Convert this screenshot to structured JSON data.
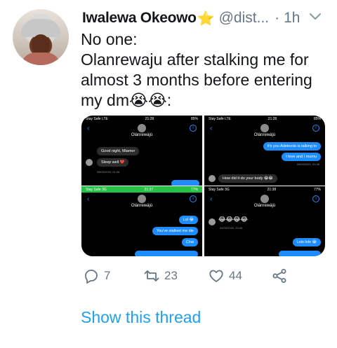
{
  "tweet": {
    "author_name": "Iwalewa Okeowo",
    "author_emoji": "⭐",
    "handle": "@dist...",
    "separator": "·",
    "time": "1h",
    "lines": [
      "No one:",
      "Olanrewaju after stalking me for",
      "almost 3 months before entering",
      "my dm😭😭:"
    ]
  },
  "media": {
    "screenshots": [
      {
        "status_left": "Stay Safe LTE",
        "status_time": "21:28",
        "status_right": "85%",
        "contact": "Olánrewájú",
        "messages": [
          {
            "dir": "in",
            "text": "Good night, Miamor"
          },
          {
            "dir": "in",
            "text": "Sleep well ❤️"
          }
        ],
        "stamp": "05/03/2020, 01:08"
      },
      {
        "status_left": "Stay Safe LTE",
        "status_time": "21:28",
        "status_right": "85%",
        "contact": "Olánrewájú",
        "messages": [
          {
            "dir": "out",
            "text": "It's you Adekunle is talking to"
          },
          {
            "dir": "out",
            "text": "I love and I mumu"
          },
          {
            "dir": "in",
            "text": "How did it do your body 😂😂"
          }
        ],
        "stamp": "05/03/2020, 01:46"
      },
      {
        "status_left": "Stay Safe 3G",
        "status_time": "21:37",
        "status_right": "77%",
        "contact": "Olánrewájú",
        "messages": [
          {
            "dir": "out",
            "text": "Lol 😂"
          },
          {
            "dir": "out",
            "text": "You've stalked me die"
          },
          {
            "dir": "out",
            "text": "Chai"
          }
        ],
        "stamp": ""
      },
      {
        "status_left": "Stay Safe 3G",
        "status_time": "21:38",
        "status_right": "77%",
        "contact": "Olánrewájú",
        "messages": [
          {
            "dir": "in",
            "text": "😂😂😂😂"
          },
          {
            "dir": "out",
            "text": "Lolo lolo 😂"
          }
        ],
        "stamp": "04/03/2020, 23:46"
      }
    ]
  },
  "actions": {
    "replies": "7",
    "retweets": "23",
    "likes": "44"
  },
  "thread_link": "Show this thread",
  "colors": {
    "text": "#14171a",
    "muted": "#657786",
    "link": "#1da1f2",
    "imessage_blue": "#1e8cff",
    "status_green": "#26c245"
  },
  "icons": [
    "reply-icon",
    "retweet-icon",
    "like-icon",
    "share-icon",
    "caret-down-icon",
    "star-emoji-icon"
  ]
}
